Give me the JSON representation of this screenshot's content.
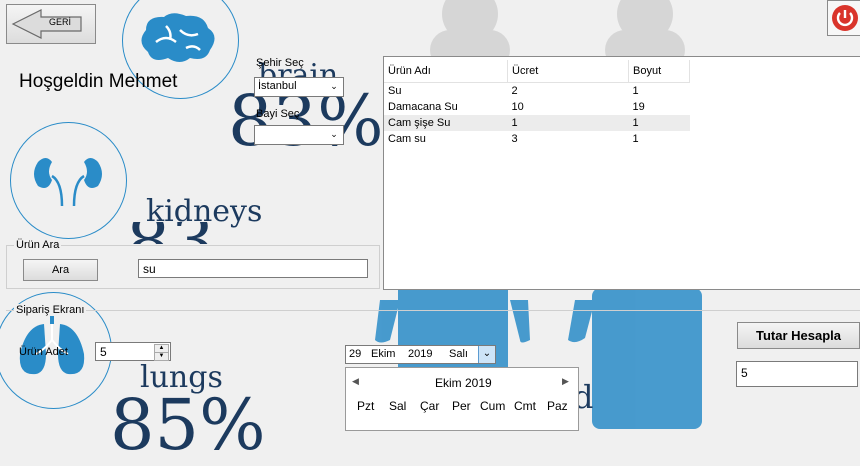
{
  "back_button": {
    "label": "GERİ"
  },
  "welcome": "Hoşgeldin Mehmet",
  "city": {
    "label": "Şehir Seç",
    "selected": "İstanbul"
  },
  "dealer": {
    "label": "Bayi Seç",
    "selected": ""
  },
  "background": {
    "brain_word": "brain",
    "brain_pct": "83%",
    "kidneys_word": "kidneys",
    "kidneys_pct": "83",
    "lungs_word": "lungs",
    "lungs_pct": "85%",
    "trailing_letter": "d"
  },
  "product_table": {
    "columns": [
      "Ürün Adı",
      "Ücret",
      "Boyut"
    ],
    "rows": [
      [
        "Su",
        "2",
        "1"
      ],
      [
        "Damacana Su",
        "10",
        "19"
      ],
      [
        "Cam şişe Su",
        "1",
        "1"
      ],
      [
        "Cam su",
        "3",
        "1"
      ]
    ],
    "selected_row": 2
  },
  "search_group": {
    "title": "Ürün Ara",
    "button": "Ara",
    "query": "su"
  },
  "order_group": {
    "title": "Sipariş Ekranı",
    "quantity_label": "Ürün Adet",
    "quantity": "5"
  },
  "date_picker": {
    "day": "29",
    "month": "Ekim",
    "year": "2019",
    "weekday": "Salı",
    "calendar_title": "Ekim 2019",
    "weekdays": [
      "Pzt",
      "Sal",
      "Çar",
      "Per",
      "Cum",
      "Cmt",
      "Paz"
    ]
  },
  "total": {
    "button": "Tutar Hesapla",
    "value": "5"
  },
  "colors": {
    "accent": "#2a8cc8",
    "text_dark": "#1c3a5e",
    "power": "#d9342b"
  },
  "icons": [
    "back-arrow-icon",
    "brain-icon",
    "kidneys-icon",
    "lungs-icon",
    "power-icon",
    "chevron-down-icon",
    "spin-up-icon",
    "spin-down-icon",
    "chevron-left-icon",
    "chevron-right-icon"
  ]
}
